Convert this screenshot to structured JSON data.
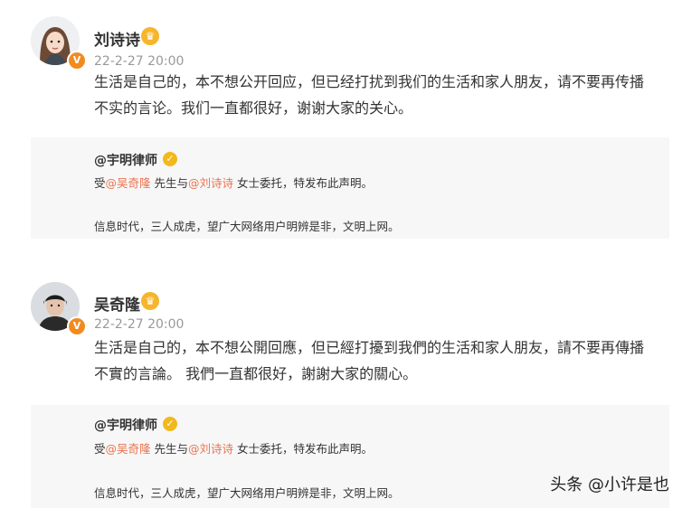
{
  "posts": [
    {
      "username": "刘诗诗",
      "time": "22-2-27 20:00",
      "text_line1": "生活是自己的，本不想公开回应，但已经打扰到我们的生活和家人朋友，请不要再传播",
      "text_line2": "不实的言论。我们一直都很好，谢谢大家的关心。",
      "repost": {
        "author": "@宇明律师",
        "line1_prefix": "受",
        "mention1": "@吴奇隆",
        "line1_mid": " 先生与",
        "mention2": "@刘诗诗",
        "line1_suffix": " 女士委托，特发布此声明。",
        "line2": "信息时代，三人成虎，望广大网络用户明辨是非，文明上网。"
      }
    },
    {
      "username": "吴奇隆",
      "time": "22-2-27 20:00",
      "text_line1": "生活是自己的，本不想公開回應，但已經打擾到我們的生活和家人朋友，請不要再傳播",
      "text_line2": "不實的言論。 我們一直都很好，謝謝大家的關心。",
      "repost": {
        "author": "@宇明律师",
        "line1_prefix": "受",
        "mention1": "@吴奇隆",
        "line1_mid": " 先生与",
        "mention2": "@刘诗诗",
        "line1_suffix": " 女士委托，特发布此声明。",
        "line2": "信息时代，三人成虎，望广大网络用户明辨是非，文明上网。"
      }
    }
  ],
  "watermark": "头条 @小许是也",
  "colors": {
    "mention": "#eb7350",
    "time": "#999999",
    "repost_bg": "#f7f7f7"
  }
}
